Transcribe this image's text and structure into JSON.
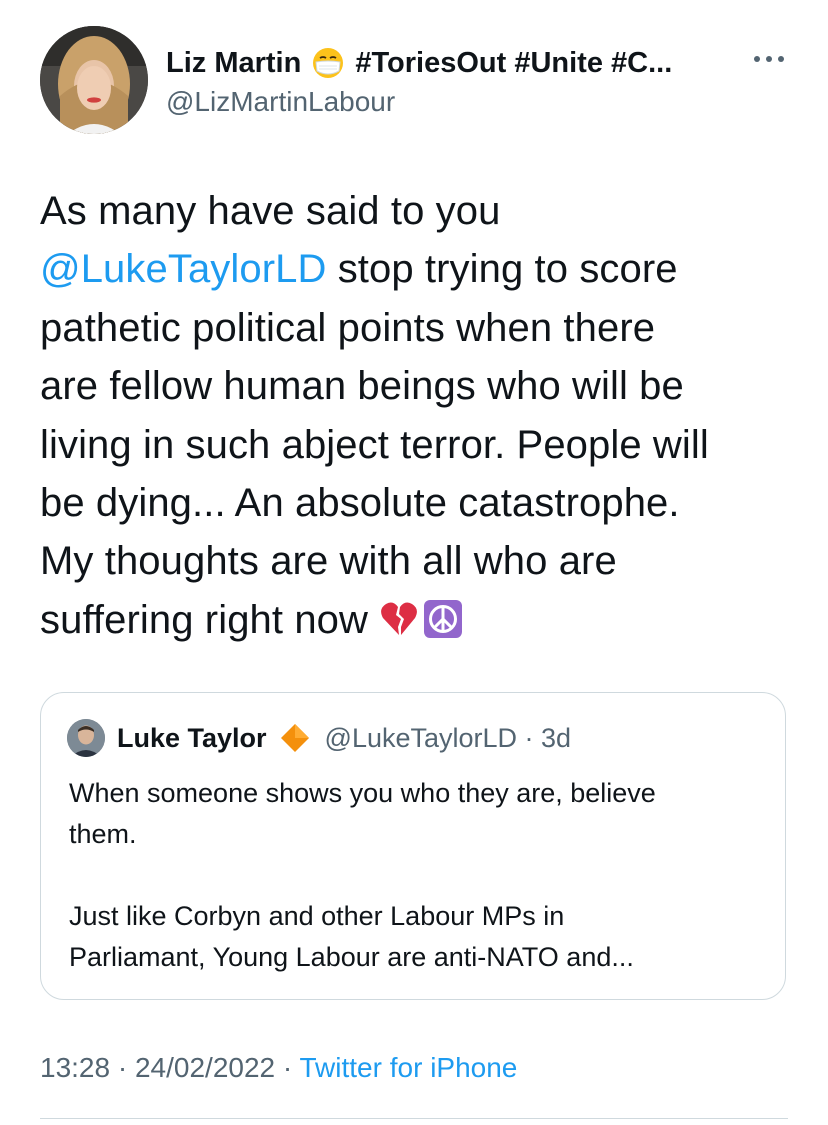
{
  "author": {
    "display_name": "Liz Martin",
    "name_emoji": "mask-emoji",
    "name_tags": "#ToriesOut #Unite #C...",
    "handle": "@LizMartinLabour"
  },
  "tweet": {
    "lines": [
      {
        "text": "As many have said to you"
      },
      {
        "mention": "@LukeTaylorLD",
        "text": " stop trying to score"
      },
      {
        "text": "pathetic political points when there"
      },
      {
        "text": "are fellow human beings who will be"
      },
      {
        "text": "living in such abject terror.  People will"
      },
      {
        "text": "be dying... An absolute catastrophe."
      },
      {
        "text": "My thoughts are with all who are"
      },
      {
        "text": "suffering right now "
      }
    ],
    "trailing_emojis": [
      "broken-heart-emoji",
      "peace-symbol-emoji"
    ]
  },
  "quoted_tweet": {
    "name": "Luke Taylor",
    "badge_icon": "orange-diamond-icon",
    "handle_time": "@LukeTaylorLD · 3d",
    "lines": [
      "When someone shows you who they are, believe",
      "them.",
      "",
      "Just like Corbyn and other Labour MPs in",
      "Parliamant, Young Labour are anti-NATO and..."
    ]
  },
  "meta": {
    "time": "13:28",
    "separator": " · ",
    "date": "24/02/2022",
    "source": "Twitter for iPhone"
  },
  "colors": {
    "accent": "#1d9bf0",
    "secondary_text": "#536471",
    "border": "#cfd9de"
  }
}
